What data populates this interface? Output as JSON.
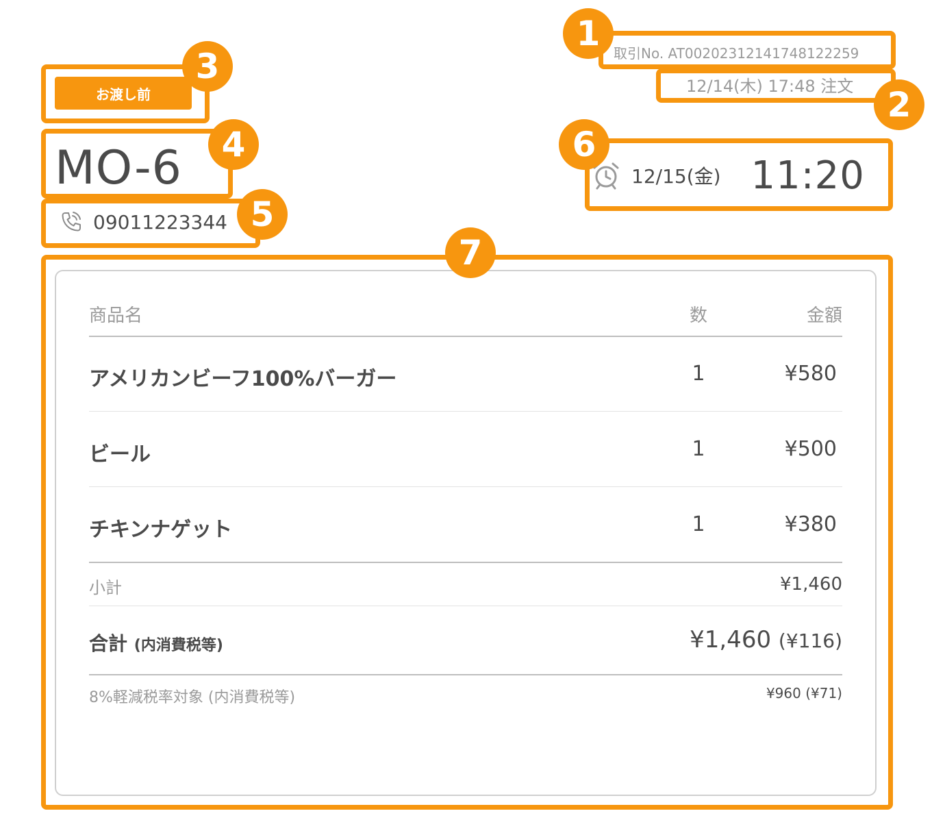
{
  "header": {
    "transaction_no": "取引No. AT00202312141748122259",
    "ordered_at": "12/14(木)  17:48  注文",
    "status_badge": "お渡し前",
    "order_code": "MO-6",
    "phone_number": "09011223344",
    "pickup_date": "12/15(金)",
    "pickup_time": "11:20"
  },
  "table": {
    "col_name": "商品名",
    "col_qty": "数",
    "col_amount": "金額",
    "items": [
      {
        "name": "アメリカンビーフ100%バーガー",
        "qty": "1",
        "amount": "¥580"
      },
      {
        "name": "ビール",
        "qty": "1",
        "amount": "¥500"
      },
      {
        "name": "チキンナゲット",
        "qty": "1",
        "amount": "¥380"
      }
    ],
    "subtotal_label": "小計",
    "subtotal_value": "¥1,460",
    "total_label": "合計",
    "total_tax_note": "(内消費税等)",
    "total_value": "¥1,460",
    "total_tax_value": "(¥116)",
    "reduced_label": "8%軽減税率対象 (内消費税等)",
    "reduced_value": "¥960 (¥71)"
  },
  "callouts": [
    "1",
    "2",
    "3",
    "4",
    "5",
    "6",
    "7"
  ],
  "icons": {
    "phone": "phone-icon",
    "alarm": "alarm-clock-icon"
  },
  "colors": {
    "accent": "#f7960f",
    "text": "#4a4a4a",
    "muted": "#9a9a9a"
  }
}
